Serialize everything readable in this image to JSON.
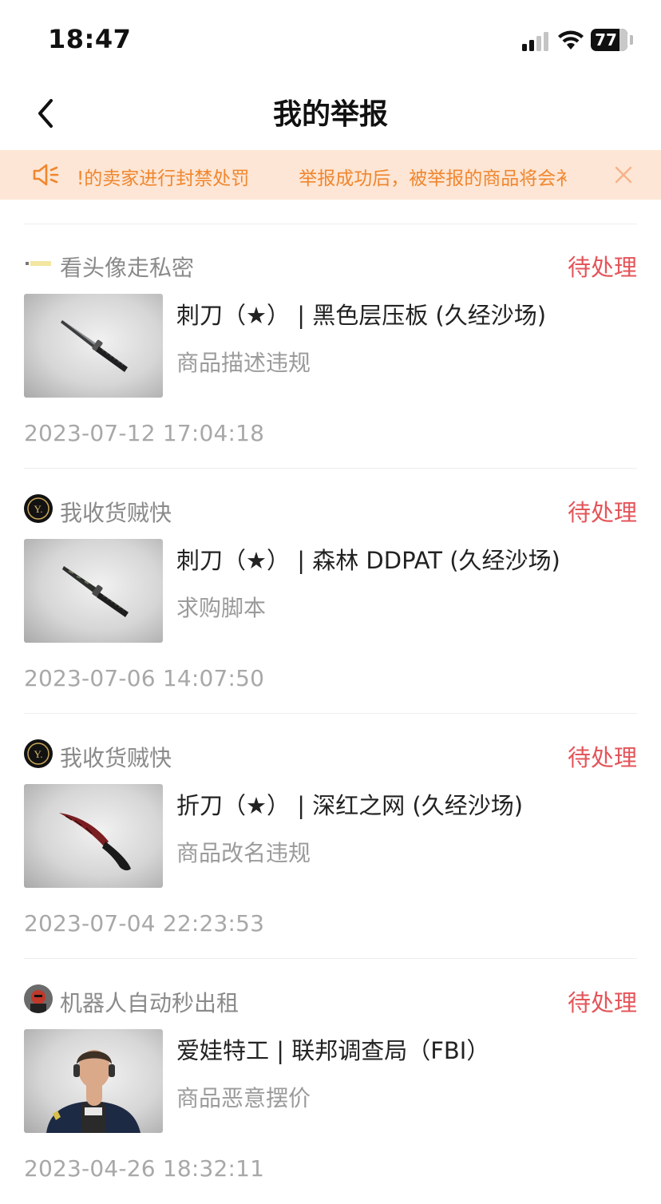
{
  "status_bar": {
    "time": "18:47",
    "battery": "77"
  },
  "nav": {
    "title": "我的举报"
  },
  "notice": {
    "text_a": "!的卖家进行封禁处罚",
    "text_b": "举报成功后，被举报的商品将会衤"
  },
  "reports": [
    {
      "seller": "看头像走私密",
      "status": "待处理",
      "item_name": "刺刀（★） | 黑色层压板 (久经沙场)",
      "reason": "商品描述违规",
      "date": "2023-07-12 17:04:18",
      "thumb_icon": "bayonet-knife-icon"
    },
    {
      "seller": "我收货贼快",
      "status": "待处理",
      "item_name": "刺刀（★） | 森林 DDPAT (久经沙场)",
      "reason": "求购脚本",
      "date": "2023-07-06 14:07:50",
      "thumb_icon": "bayonet-knife-icon"
    },
    {
      "seller": "我收货贼快",
      "status": "待处理",
      "item_name": "折刀（★） | 深红之网 (久经沙场)",
      "reason": "商品改名违规",
      "date": "2023-07-04 22:23:53",
      "thumb_icon": "flip-knife-icon"
    },
    {
      "seller": "机器人自动秒出租",
      "status": "待处理",
      "item_name": "爱娃特工 | 联邦调查局（FBI）",
      "reason": "商品恶意摆价",
      "date": "2023-04-26 18:32:11",
      "thumb_icon": "agent-portrait-icon"
    }
  ],
  "colors": {
    "status_pending": "#e4555a",
    "notice_bg": "#fde6d5",
    "notice_text": "#f0862e"
  }
}
